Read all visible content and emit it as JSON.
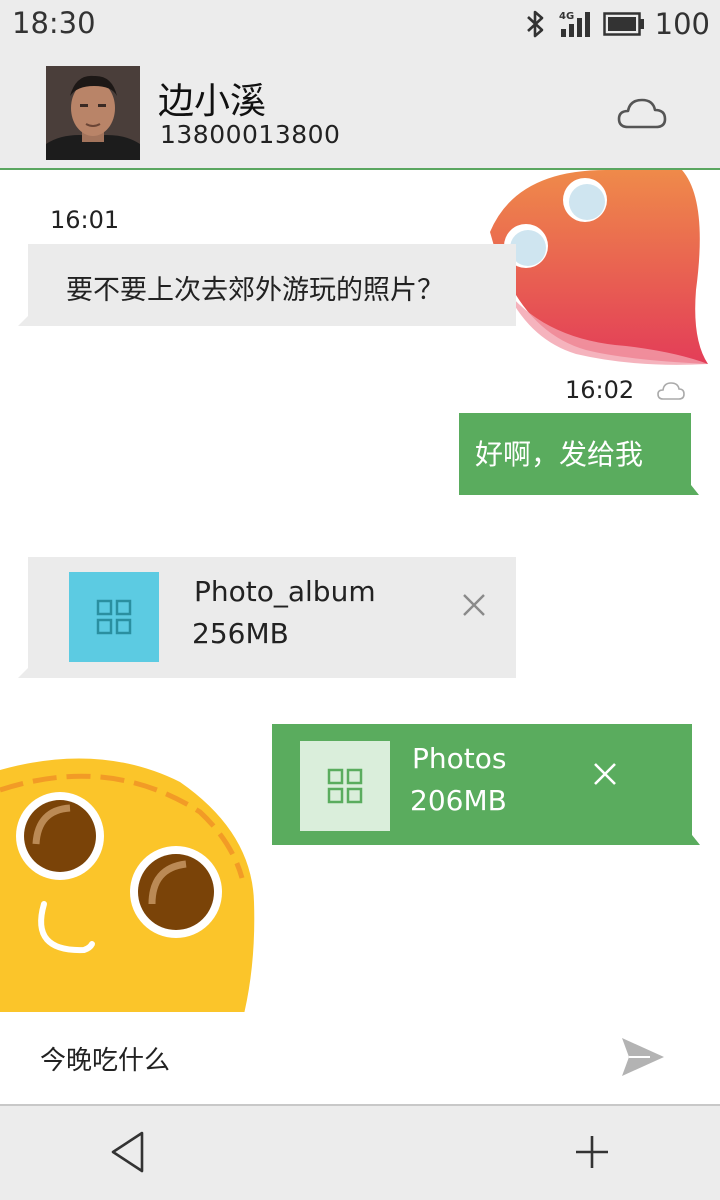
{
  "status_bar": {
    "time": "18:30",
    "network": "4G",
    "battery_percent": "100",
    "icons": [
      "bluetooth-icon",
      "signal-icon",
      "battery-icon"
    ]
  },
  "header": {
    "contact_name": "边小溪",
    "contact_phone": "13800013800",
    "sync_icon": "cloud-icon"
  },
  "messages": [
    {
      "direction": "incoming",
      "time": "16:01",
      "text": "要不要上次去郊外游玩的照片？"
    },
    {
      "direction": "outgoing",
      "time": "16:02",
      "text": "好啊，发给我"
    }
  ],
  "files": [
    {
      "direction": "incoming",
      "name": "Photo_album",
      "size": "256MB"
    },
    {
      "direction": "outgoing",
      "name": "Photos",
      "size": "206MB"
    }
  ],
  "input": {
    "value": "今晚吃什么"
  },
  "colors": {
    "accent_green": "#5aac5e",
    "incoming_bubble": "#ebebeb",
    "file_icon_blue": "#5ccbe2",
    "bar_background": "#ececec"
  }
}
